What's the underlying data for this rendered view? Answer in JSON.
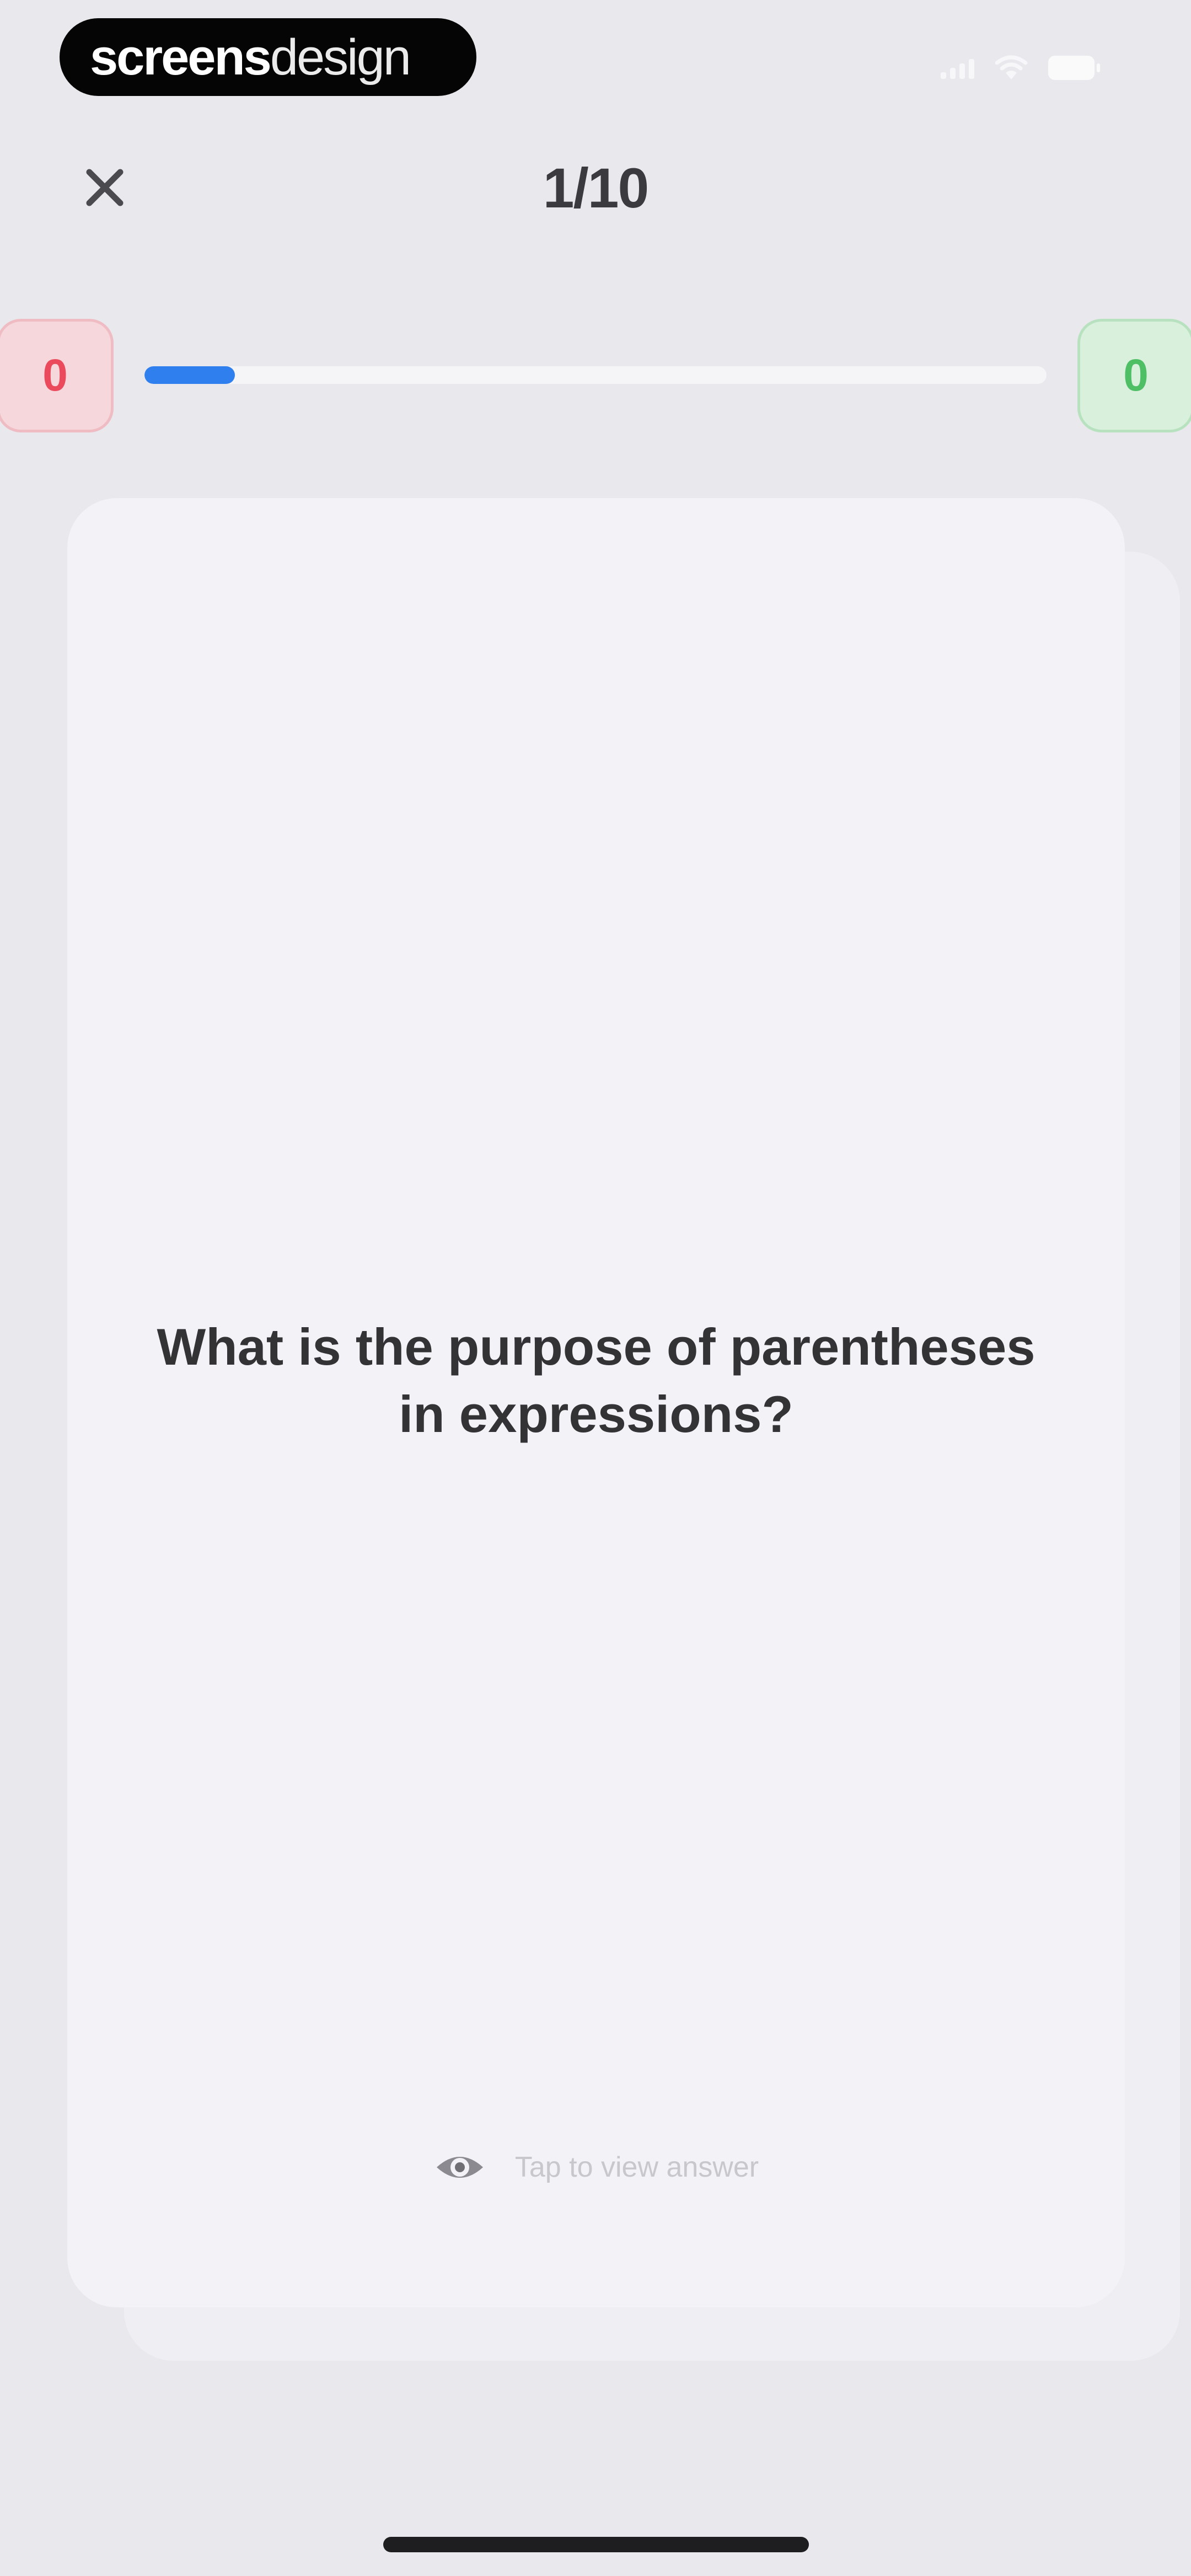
{
  "status_bar": {
    "brand_part1": "screens",
    "brand_part2": "design",
    "signal_icon": "signal-icon",
    "wifi_icon": "wifi-icon",
    "battery_icon": "battery-icon"
  },
  "header": {
    "close_icon": "close-icon",
    "counter": "1/10"
  },
  "score": {
    "wrong_count": "0",
    "correct_count": "0",
    "progress_fraction": 0.1,
    "colors": {
      "wrong": "#ea4a5b",
      "correct": "#4fbf65",
      "progress": "#2f80ee"
    }
  },
  "card": {
    "question": "What is the purpose of parentheses in expressions?",
    "hint_icon": "eye-icon",
    "hint_label": "Tap to view answer"
  }
}
